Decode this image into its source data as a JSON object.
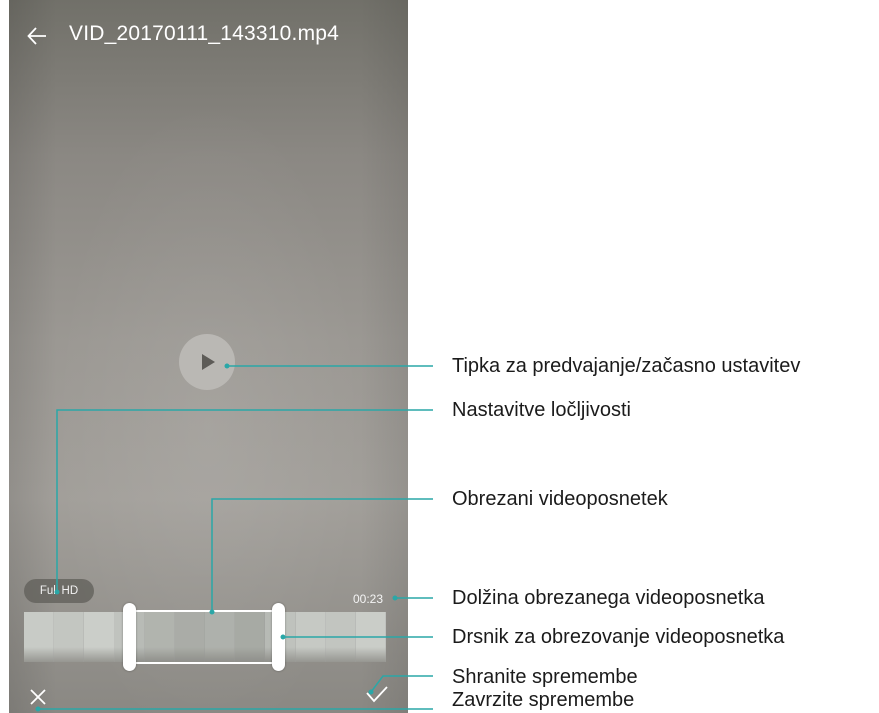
{
  "player": {
    "back_icon": "arrow-left-icon",
    "file_name": "VID_20170111_143310.mp4",
    "play_icon": "play-icon",
    "resolution_label": "Full HD",
    "trimmed_duration": "00:23",
    "discard_icon": "close-x-icon",
    "save_icon": "checkmark-icon"
  },
  "filmstrip": {
    "frame_count": 12,
    "frame_colors": [
      "#c8cbc6",
      "#c3c6c1",
      "#cbcec9",
      "#c0c3be",
      "#b9bcb6",
      "#b1b4ae",
      "#b6b9b3",
      "#aeb1ab",
      "#bfc2bd",
      "#c6c9c4",
      "#c2c5c0",
      "#cacdc8"
    ]
  },
  "callouts": [
    {
      "id": "play",
      "text": "Tipka za predvajanje/začasno ustavitev"
    },
    {
      "id": "resolution",
      "text": "Nastavitve ločljivosti"
    },
    {
      "id": "trimmed",
      "text": "Obrezani videoposnetek"
    },
    {
      "id": "duration",
      "text": "Dolžina obrezanega videoposnetka"
    },
    {
      "id": "slider",
      "text": "Drsnik za obrezovanje videoposnetka"
    },
    {
      "id": "save",
      "text": "Shranite spremembe"
    },
    {
      "id": "discard",
      "text": "Zavrzite spremembe"
    }
  ],
  "colors": {
    "leader_line": "#2aa7a7",
    "callout_text": "#1b1b1b",
    "overlay_text": "#ffffff"
  }
}
